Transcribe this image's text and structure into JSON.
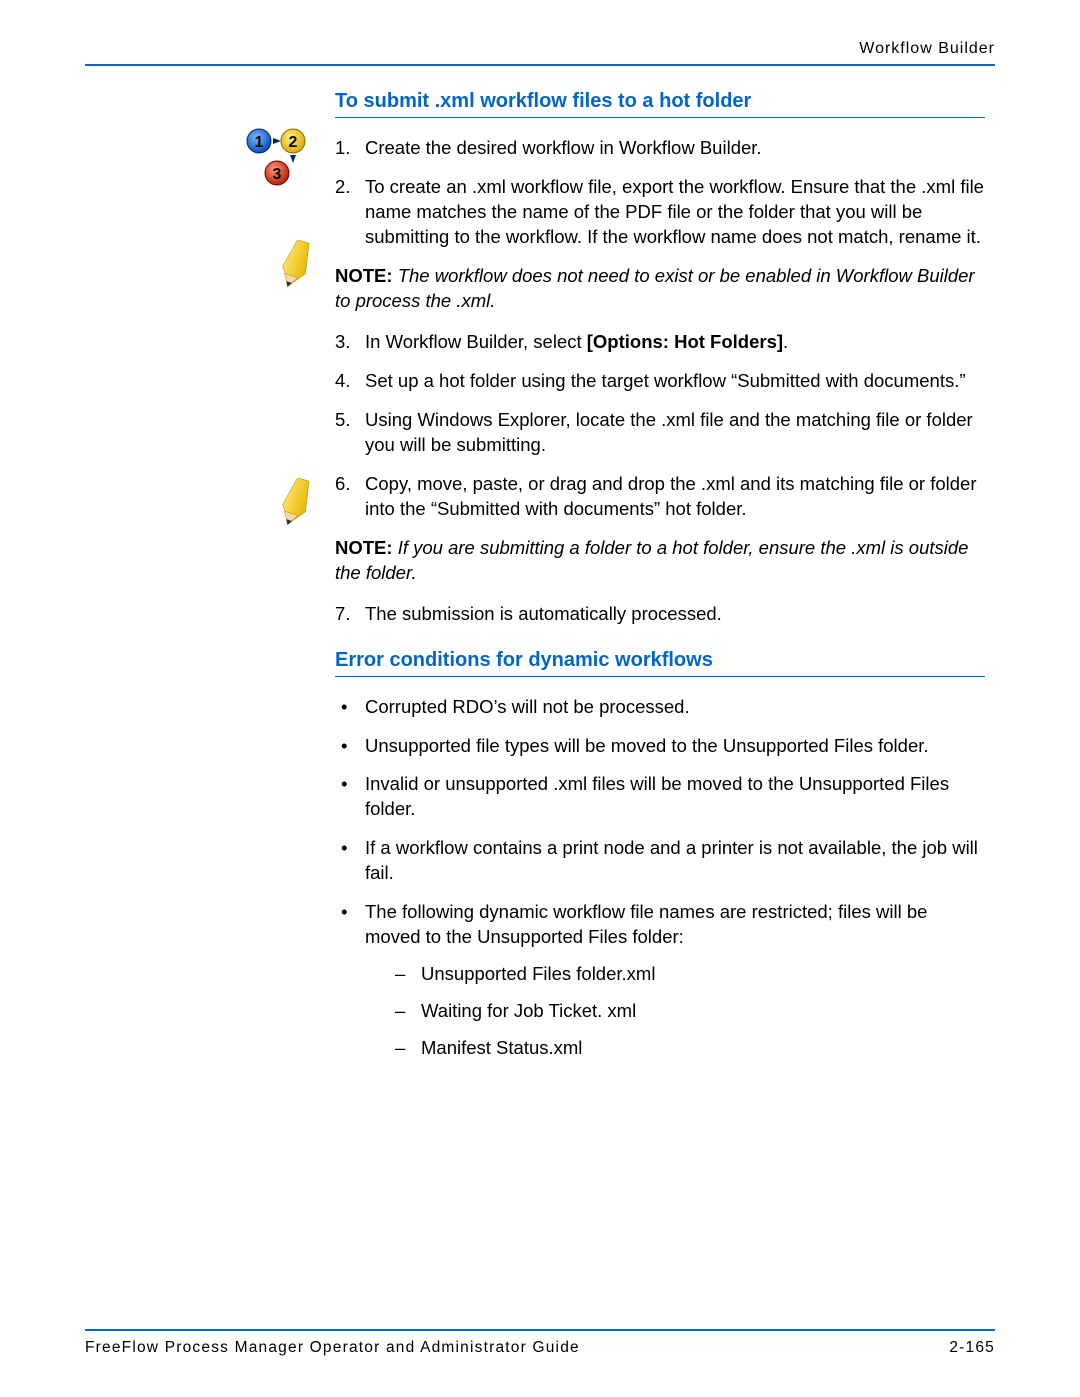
{
  "header": {
    "label": "Workflow Builder"
  },
  "section1": {
    "heading": "To submit .xml workflow files to a hot folder",
    "steps_a": [
      "Create the desired workflow in Workflow Builder.",
      "To create an .xml workflow file, export the workflow. Ensure that the .xml file name matches the name of the PDF file or the folder that you will be submitting to the workflow. If the workflow name does not match, rename it."
    ],
    "note1_label": "NOTE:",
    "note1_text": " The workflow does not need to exist or be enabled in Workflow Builder to process the .xml.",
    "step3_prefix": "In Workflow Builder, select ",
    "step3_bold": "[Options: Hot Folders]",
    "step3_suffix": ".",
    "steps_b": [
      "Set up a hot folder using the target workflow “Submitted with documents.”",
      "Using Windows Explorer, locate the .xml file and the matching file or folder you will be submitting.",
      "Copy, move, paste, or drag and drop the .xml and its matching file or folder into the “Submitted with documents” hot folder."
    ],
    "note2_label": "NOTE:",
    "note2_text": " If you are submitting a folder to a hot folder, ensure the .xml is outside the folder.",
    "steps_c": [
      "The submission is automatically processed."
    ]
  },
  "section2": {
    "heading": "Error conditions for dynamic workflows",
    "bullets": [
      "Corrupted RDO’s will not be processed.",
      "Unsupported file types will be moved to the Unsupported Files folder.",
      "Invalid or unsupported .xml files will be moved to the Unsupported Files folder.",
      "If a workflow contains a print node and a printer is not available, the job will fail."
    ],
    "bullet5": "The following dynamic workflow file names are restricted; files will be moved to the Unsupported Files folder:",
    "dashes": [
      "Unsupported Files folder.xml",
      "Waiting for Job Ticket. xml",
      "Manifest Status.xml"
    ]
  },
  "footer": {
    "title": "FreeFlow Process Manager Operator and Administrator Guide",
    "page": "2-165"
  }
}
